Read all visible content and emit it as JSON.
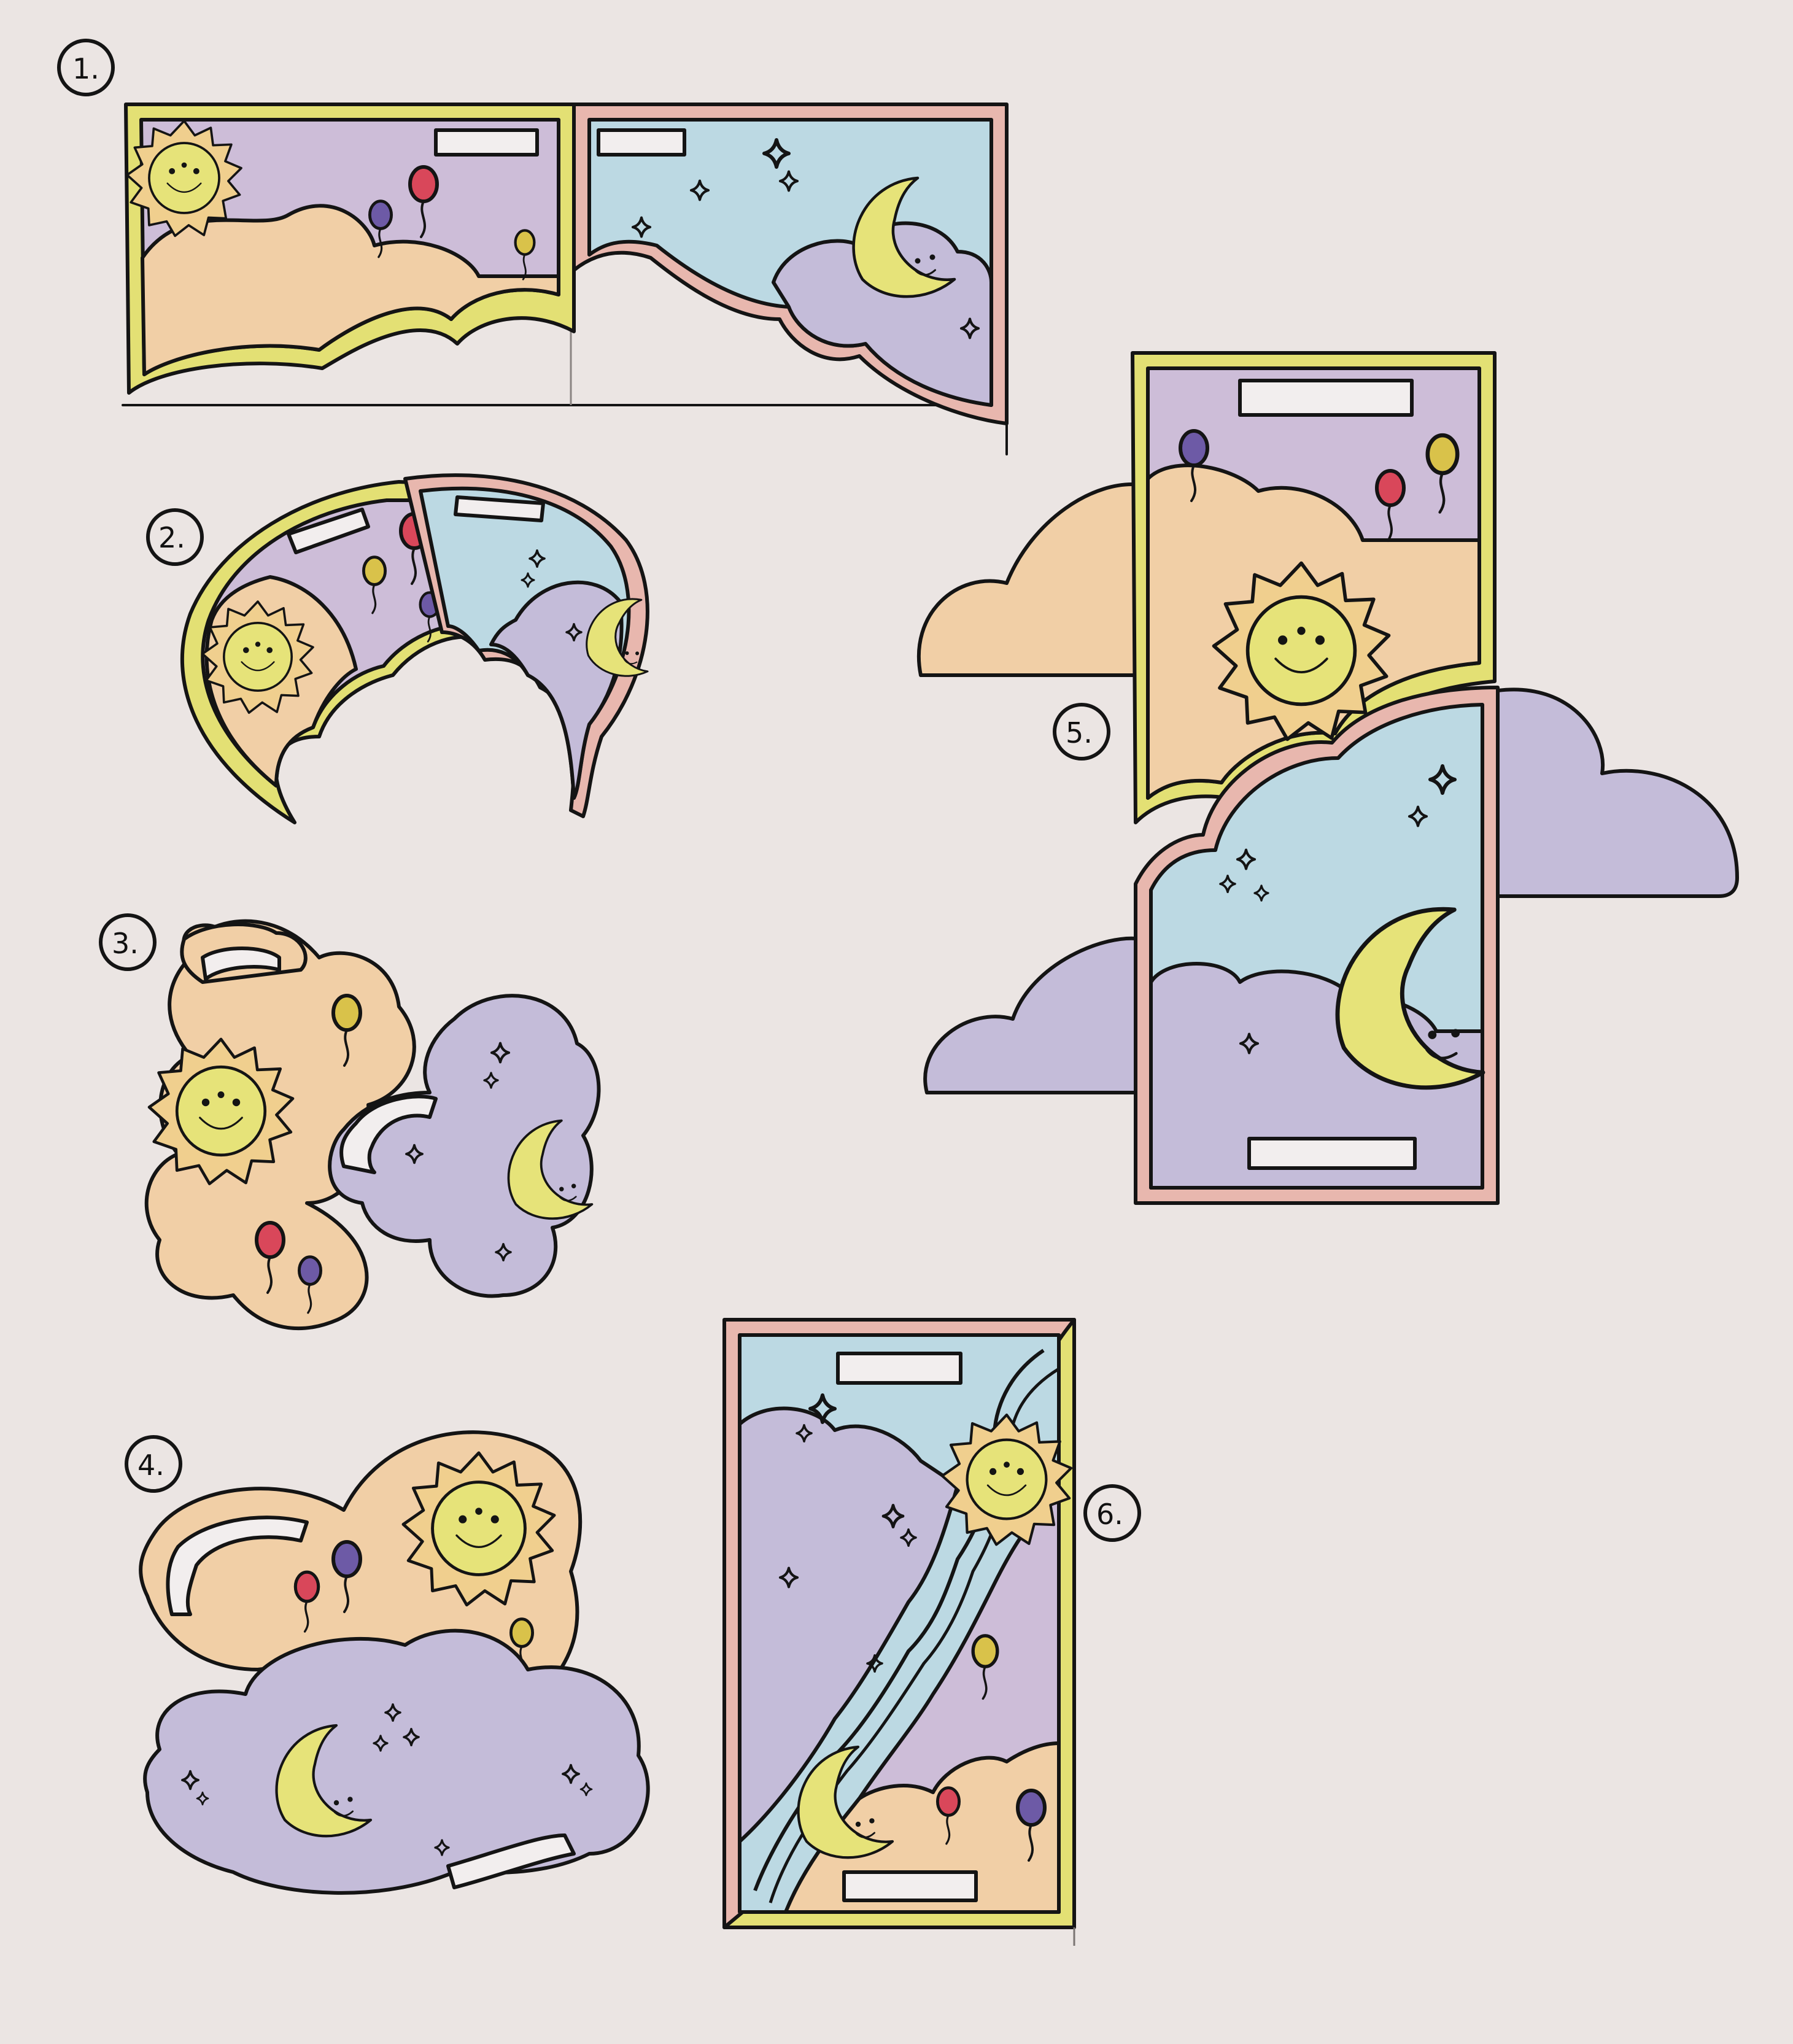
{
  "steps": [
    {
      "label": "1."
    },
    {
      "label": "2."
    },
    {
      "label": "3."
    },
    {
      "label": "4."
    },
    {
      "label": "5."
    },
    {
      "label": "6."
    }
  ],
  "colors": {
    "paper": "#ebe5e3",
    "sky_purple": "#cdbdd8",
    "sky_blue": "#bcd9e3",
    "cloud_orange": "#f1cfa6",
    "cloud_purple": "#c4bcd9",
    "sun_yellow": "#e6e379",
    "frame_yellow": "#e3e074",
    "frame_pink": "#e8b7ae",
    "balloon_red": "#d9475a",
    "balloon_purple": "#6d5aa6",
    "balloon_yellow": "#d9c24a"
  },
  "icons": [
    "sun-face-icon",
    "crescent-moon-face-icon",
    "balloon-icon",
    "sparkle-star-icon",
    "cloud-icon",
    "label-plate-icon"
  ]
}
